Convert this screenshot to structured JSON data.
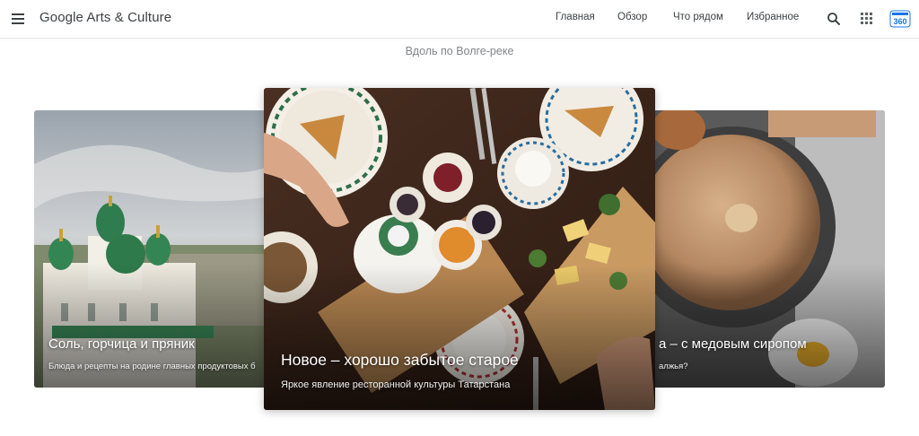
{
  "header": {
    "logo": "Google Arts & Culture",
    "nav": [
      "Главная",
      "Обзор",
      "Что рядом",
      "Избранное"
    ],
    "icons": {
      "menu": "menu-icon",
      "search": "search-icon",
      "apps": "apps-grid-icon",
      "badge": "arts-360-icon"
    },
    "badge_text": "360"
  },
  "section": {
    "title": "Вдоль по Волге-реке"
  },
  "cards": [
    {
      "title": "Соль, горчица и пряник",
      "subtitle": "Блюда и рецепты на родине главных продуктовых б"
    },
    {
      "title": "Новое – хорошо забытое старое",
      "subtitle": "Яркое явление ресторанной культуры Татарстана"
    },
    {
      "title": "а – с медовым сиропом",
      "subtitle": "алжья?"
    }
  ],
  "colors": {
    "text_dark": "#3c4043",
    "text_muted": "#80868b",
    "badge_blue": "#1a73e8"
  }
}
